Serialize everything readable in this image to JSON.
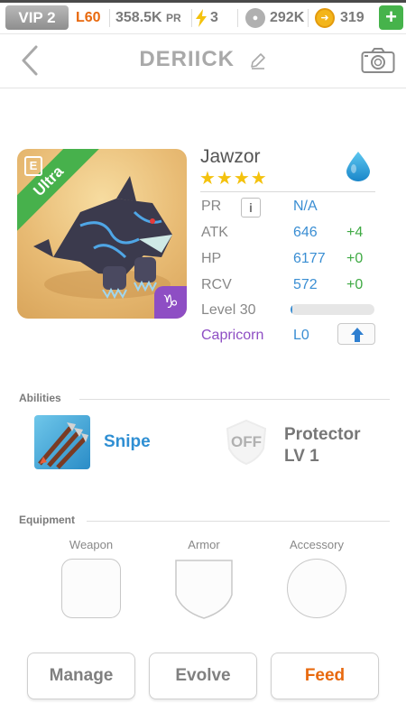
{
  "status_bar": {
    "vip": "VIP 2",
    "level": "L60",
    "pr_value": "358.5K",
    "pr_unit": "PR",
    "energy": "3",
    "food": "292K",
    "coins": "319",
    "add": "+"
  },
  "header": {
    "title": "DERIICK"
  },
  "pet": {
    "rarity": "Ultra",
    "name": "Jawzor",
    "star_count": 4,
    "stars": "★★★★",
    "element_icon": "water-drop-icon",
    "zodiac_glyph": "♑",
    "stats": [
      {
        "label": "PR",
        "value": "N/A",
        "bonus": ""
      },
      {
        "label": "ATK",
        "value": "646",
        "bonus": "+4"
      },
      {
        "label": "HP",
        "value": "6177",
        "bonus": "+0"
      },
      {
        "label": "RCV",
        "value": "572",
        "bonus": "+0"
      }
    ],
    "info_glyph": "i",
    "level": "Level 30",
    "level_progress": 0.02,
    "zodiac": "Capricorn",
    "zodiac_level": "L0"
  },
  "abilities": {
    "section_label": "Abilities",
    "items": [
      {
        "name": "Snipe",
        "icon": "snipe-icon"
      },
      {
        "name": "Protector",
        "level": "LV 1",
        "status": "OFF",
        "icon": "protector-icon"
      }
    ]
  },
  "equipment": {
    "section_label": "Equipment",
    "slots": [
      "Weapon",
      "Armor",
      "Accessory"
    ]
  },
  "actions": {
    "manage": "Manage",
    "evolve": "Evolve",
    "feed": "Feed"
  },
  "colors": {
    "accent_orange": "#e8690e",
    "accent_blue": "#3a8ed3",
    "accent_green": "#3faa44",
    "zodiac_purple": "#8e4ec4"
  }
}
